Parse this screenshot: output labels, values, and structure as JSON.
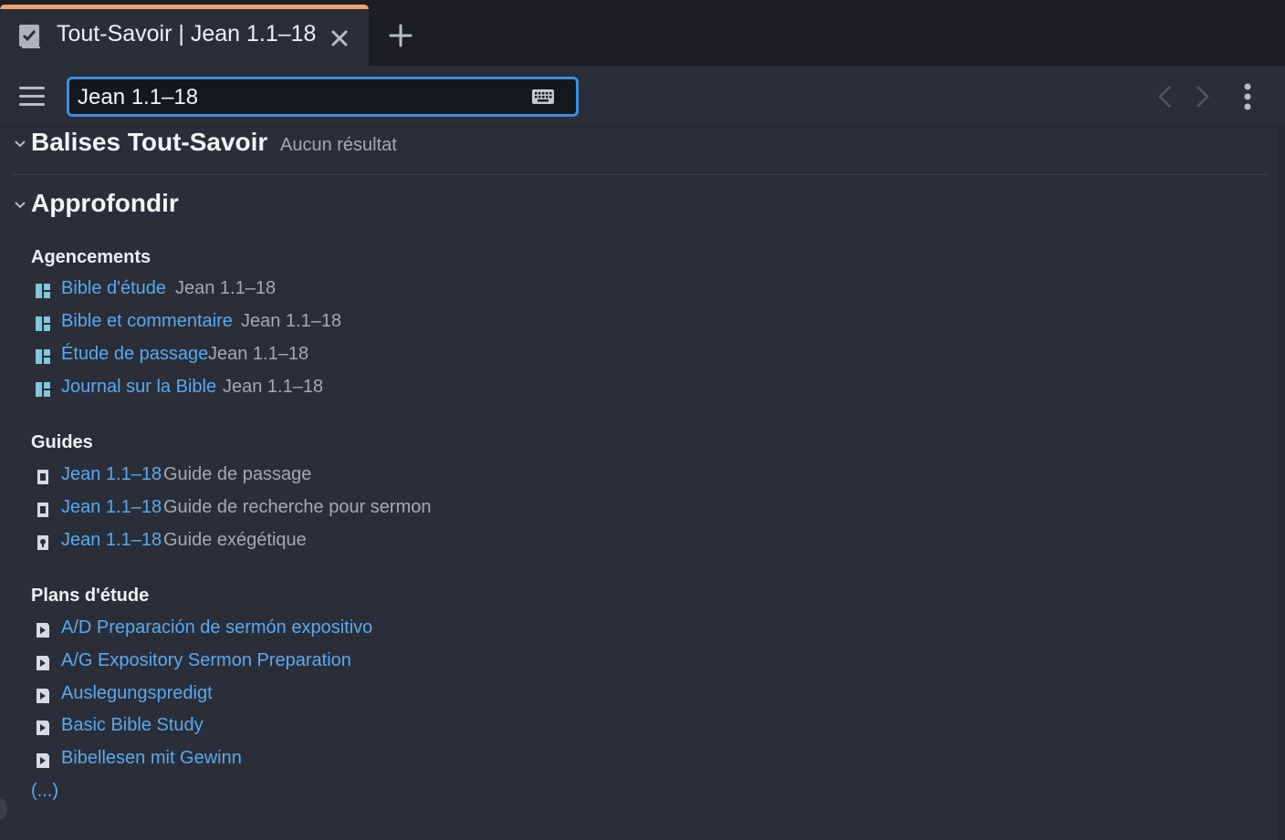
{
  "tab": {
    "title": "Tout-Savoir | Jean 1.1–18",
    "icon": "checkbox-document-icon",
    "accent_color": "#f0a070"
  },
  "toolbar": {
    "search_value": "Jean 1.1–18",
    "focus_color": "#3d8de0"
  },
  "sections": {
    "balises": {
      "title": "Balises Tout-Savoir",
      "note": "Aucun résultat"
    },
    "approfondir": {
      "title": "Approfondir",
      "agencements": {
        "title": "Agencements",
        "items": [
          {
            "label": "Bible d'étude",
            "meta": "Jean 1.1–18"
          },
          {
            "label": "Bible et commentaire",
            "meta": "Jean 1.1–18"
          },
          {
            "label": "Étude de passage",
            "meta": "Jean 1.1–18"
          },
          {
            "label": "Journal sur la Bible",
            "meta": "Jean 1.1–18"
          }
        ]
      },
      "guides": {
        "title": "Guides",
        "items": [
          {
            "label": "Jean 1.1–18",
            "meta": "Guide de passage"
          },
          {
            "label": "Jean 1.1–18",
            "meta": "Guide de recherche pour sermon"
          },
          {
            "label": "Jean 1.1–18",
            "meta": "Guide exégétique"
          }
        ]
      },
      "plans": {
        "title": "Plans d'étude",
        "items": [
          {
            "label": "A/D Preparación de sermón expositivo"
          },
          {
            "label": "A/G Expository Sermon Preparation"
          },
          {
            "label": "Auslegungspredigt"
          },
          {
            "label": "Basic Bible Study"
          },
          {
            "label": "Bibellesen mit Gewinn"
          }
        ],
        "more": "(...)"
      }
    }
  },
  "colors": {
    "link": "#5aa9f0",
    "layout_icon": "#7fc8d8",
    "background": "#2a2e38"
  }
}
